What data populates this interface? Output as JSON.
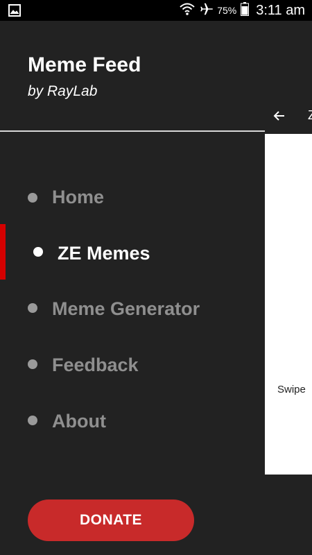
{
  "status_bar": {
    "battery_percent": "75%",
    "time": "3:11 am",
    "icons": [
      "image-notification-icon",
      "wifi-icon",
      "airplane-mode-icon",
      "battery-icon"
    ]
  },
  "drawer": {
    "title": "Meme Feed",
    "subtitle": "by RayLab",
    "items": [
      {
        "label": "Home",
        "active": false
      },
      {
        "label": "ZE Memes",
        "active": true
      },
      {
        "label": "Meme Generator",
        "active": false
      },
      {
        "label": "Feedback",
        "active": false
      },
      {
        "label": "About",
        "active": false
      }
    ],
    "donate_label": "DONATE"
  },
  "background_app": {
    "toolbar_title": "Z",
    "card_text": "Swipe"
  },
  "colors": {
    "drawer_bg": "#222222",
    "accent_red": "#d40000",
    "donate_bg": "#c82a2a",
    "inactive_text": "#8f8f8f",
    "active_text": "#ffffff"
  }
}
